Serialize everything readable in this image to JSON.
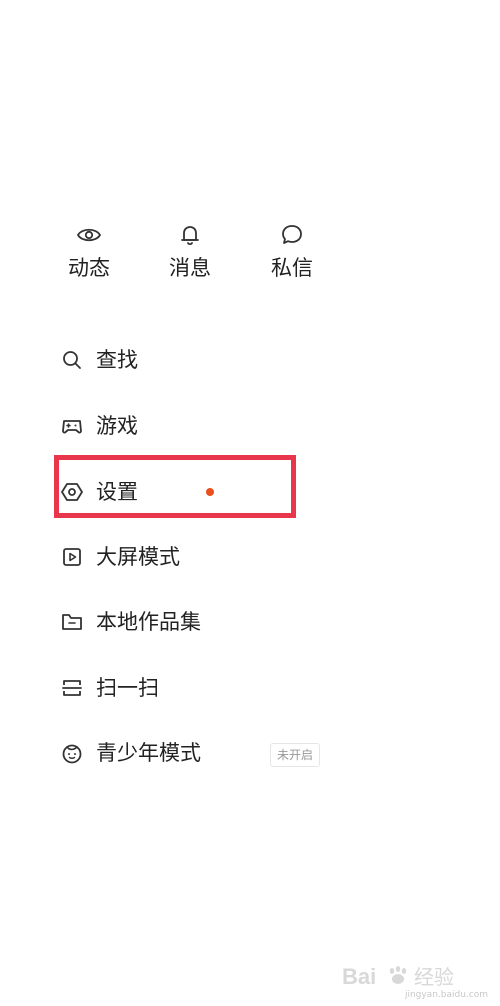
{
  "quick_actions": [
    {
      "label": "动态",
      "icon": "eye-icon"
    },
    {
      "label": "消息",
      "icon": "bell-icon"
    },
    {
      "label": "私信",
      "icon": "chat-bubble-icon"
    }
  ],
  "menu": [
    {
      "label": "查找",
      "icon": "search-icon"
    },
    {
      "label": "游戏",
      "icon": "gamepad-icon"
    },
    {
      "label": "设置",
      "icon": "settings-hexagon-icon",
      "badge": "red-dot"
    },
    {
      "label": "大屏模式",
      "icon": "play-square-icon"
    },
    {
      "label": "本地作品集",
      "icon": "folder-icon"
    },
    {
      "label": "扫一扫",
      "icon": "scan-icon"
    },
    {
      "label": "青少年模式",
      "icon": "child-face-icon",
      "status": "未开启"
    }
  ],
  "colors": {
    "text": "#222222",
    "icon": "#333333",
    "red_dot": "#e8501e",
    "highlight": "#e8364d",
    "tag_text": "#999999"
  },
  "watermark": {
    "text": "Bai 经验",
    "url": "jingyan.baidu.com"
  }
}
